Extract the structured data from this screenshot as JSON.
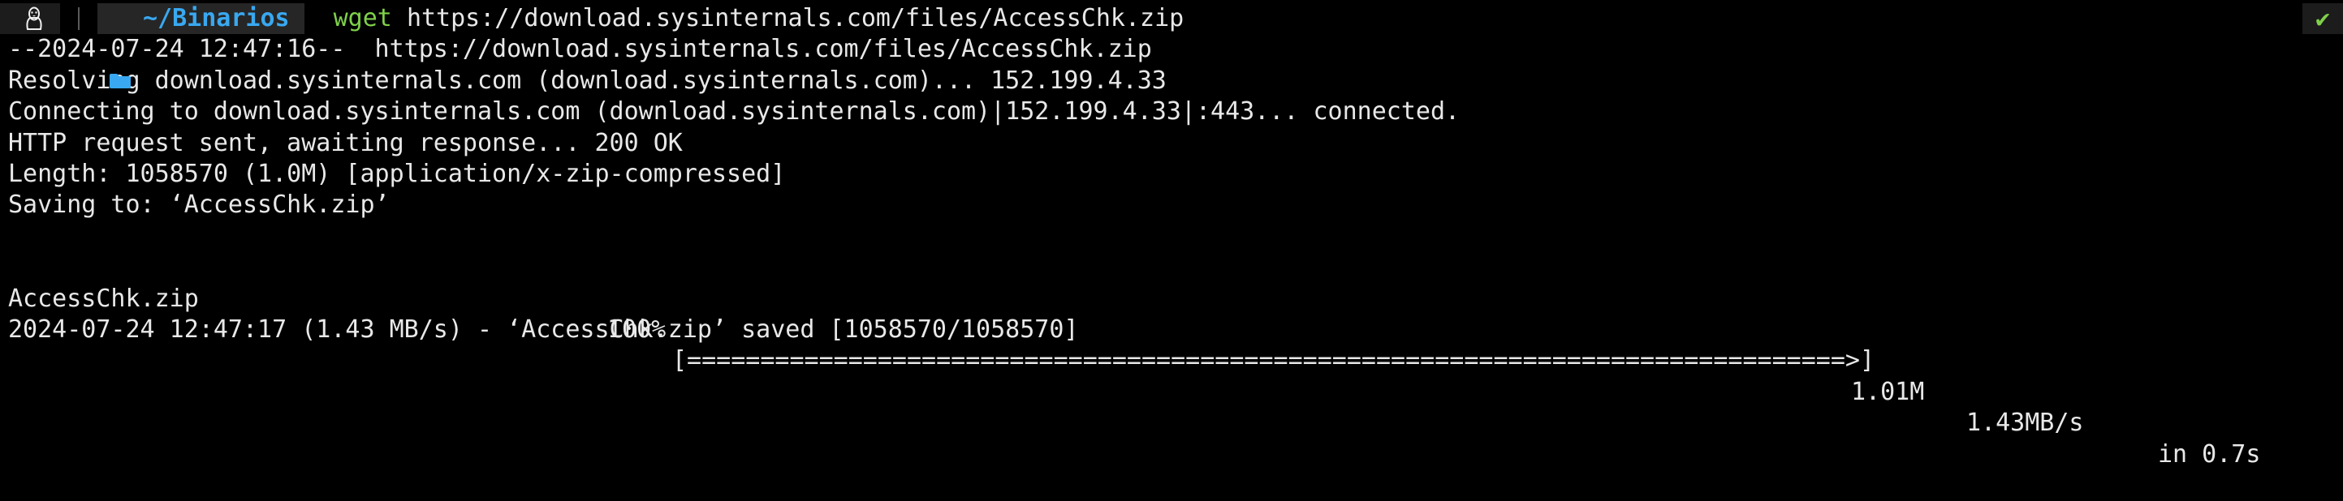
{
  "prompt": {
    "os_icon": "linux-penguin-icon",
    "dir_icon": "folder-icon",
    "directory": "~/Binarios",
    "command": "wget",
    "argument": "https://download.sysinternals.com/files/AccessChk.zip",
    "status_icon": "check-icon",
    "status_glyph": "✔",
    "colors": {
      "directory": "#39a8f0",
      "command": "#7fd04a",
      "status": "#7fd04a"
    }
  },
  "output": {
    "line1": "--2024-07-24 12:47:16--  https://download.sysinternals.com/files/AccessChk.zip",
    "line2": "Resolving download.sysinternals.com (download.sysinternals.com)... 152.199.4.33",
    "line3": "Connecting to download.sysinternals.com (download.sysinternals.com)|152.199.4.33|:443... connected.",
    "line4": "HTTP request sent, awaiting response... 200 OK",
    "line5": "Length: 1058570 (1.0M) [application/x-zip-compressed]",
    "line6": "Saving to: ‘AccessChk.zip’",
    "progress": {
      "filename": "AccessChk.zip",
      "percent": "100%",
      "bar": "[===============================================================================>]",
      "downloaded": "1.01M",
      "rate": "1.43MB/s",
      "elapsed": "in 0.7s",
      "fraction": 1.0
    },
    "final": "2024-07-24 12:47:17 (1.43 MB/s) - ‘AccessChk.zip’ saved [1058570/1058570]"
  }
}
